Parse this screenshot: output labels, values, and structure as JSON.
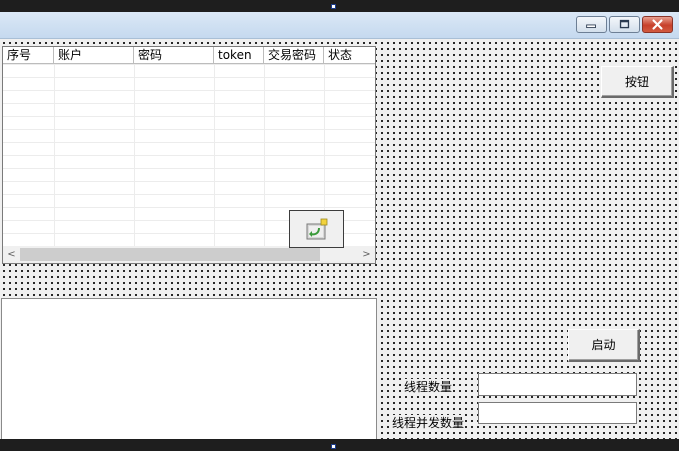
{
  "window": {
    "caption_buttons": [
      "minimize",
      "maximize",
      "close"
    ]
  },
  "list": {
    "columns": [
      "序号",
      "账户",
      "密码",
      "token",
      "交易密码",
      "状态"
    ],
    "rows": [],
    "scroll_left_arrow": "<",
    "scroll_right_arrow": ">"
  },
  "buttons": {
    "top_label": "按钮",
    "start_label": "启动"
  },
  "fields": {
    "thread_count_label": "线程数量",
    "thread_count_value": "",
    "thread_concurrency_label": "线程并发数量",
    "thread_concurrency_value": ""
  },
  "icons": {
    "image_button": "refresh-picture-icon"
  }
}
